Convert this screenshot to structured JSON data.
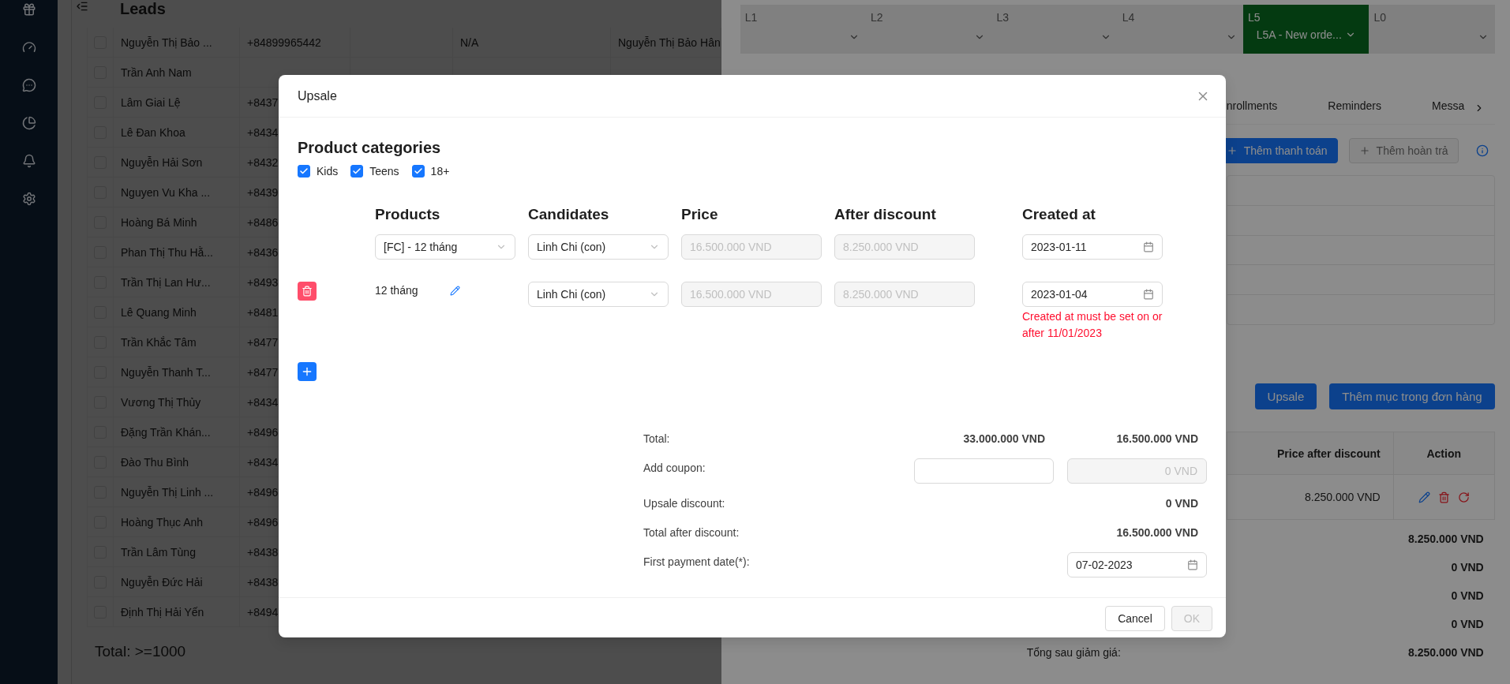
{
  "leads": {
    "title": "Leads",
    "rows": [
      {
        "name": "Nguyễn Thị Bảo ...",
        "phone": "+84899965442",
        "column_4": "N/A",
        "column_5": "Nguyễn Thị Bảo Hân",
        "checked": false
      },
      {
        "name": "Trần Anh Nam",
        "checked": false
      },
      {
        "name": "Lâm Giai Lệ",
        "phone": "+8437",
        "checked": false
      },
      {
        "name": "Lê Đan Khoa",
        "phone": "+8434",
        "checked": false
      },
      {
        "name": "Nguyễn Hải Sơn",
        "phone": "+8432",
        "checked": false
      },
      {
        "name": "Nguyen Vu Kha ...",
        "phone": "+8439",
        "checked": false
      },
      {
        "name": "Hoàng Bá Minh",
        "phone": "+8486",
        "checked": false
      },
      {
        "name": "Phan Thị Thu Hằ...",
        "phone": "+8436",
        "checked": false
      },
      {
        "name": "Trần Thị Lan Hư...",
        "phone": "+8493",
        "checked": false
      },
      {
        "name": "Lê Quang Minh",
        "phone": "+8481",
        "checked": false
      },
      {
        "name": "Trần Khắc Tâm",
        "phone": "+8477",
        "checked": false
      },
      {
        "name": "Nguyễn Thanh T...",
        "phone": "+8477",
        "checked": false
      },
      {
        "name": "Vương Thị Thủy",
        "phone": "+8434",
        "checked": false
      },
      {
        "name": "Đặng Trần Khán...",
        "phone": "+8496",
        "checked": false
      },
      {
        "name": "Đào Thu Bình",
        "phone": "+8434",
        "checked": false
      },
      {
        "name": "Nguyễn Thị Linh ...",
        "phone": "+8496",
        "checked": false
      },
      {
        "name": "Hoàng Thục Anh",
        "phone": "+8496",
        "checked": false
      },
      {
        "name": "Trần Lâm Tùng",
        "phone": "+8438",
        "checked": false
      },
      {
        "name": "Nguyễn Đức Hải",
        "phone": "+8438",
        "checked": false
      },
      {
        "name": "Định Thị Hải Yến",
        "phone": "+8494",
        "checked": false
      }
    ],
    "total": "Total: >=1000"
  },
  "stages": [
    {
      "label": "L1",
      "selected": false
    },
    {
      "label": "L2",
      "selected": false
    },
    {
      "label": "L3",
      "selected": false
    },
    {
      "label": "L4",
      "selected": false
    },
    {
      "label": "L5",
      "value": "L5A - New orde...",
      "selected": true
    },
    {
      "label": "L0",
      "selected": false
    }
  ],
  "tabs": [
    "nrollments",
    "Reminders",
    "Messa"
  ],
  "payment_buttons": [
    {
      "label": "Thêm thanh toán",
      "disabled": false
    },
    {
      "label": "Thêm hoàn trả",
      "disabled": true
    }
  ],
  "order_buttons": [
    "Upsale",
    "Thêm mục trong đơn hàng"
  ],
  "order_table": {
    "columns": [
      "Price after discount",
      "Action"
    ],
    "rows": [
      {
        "price_after_discount": "8.250.000 VND"
      }
    ]
  },
  "order_summary": [
    {
      "value": "8.250.000 VND"
    },
    {
      "value": "0 VND"
    },
    {
      "value": "0 VND"
    },
    {
      "value": "0 VND"
    },
    {
      "label": "Tổng sau giảm giá:",
      "value": "8.250.000 VND"
    }
  ],
  "modal": {
    "title": "Upsale",
    "categories_title": "Product categories",
    "categories": [
      {
        "label": "Kids",
        "checked": true
      },
      {
        "label": "Teens",
        "checked": true
      },
      {
        "label": "18+",
        "checked": true
      }
    ],
    "columns": [
      "Products",
      "Candidates",
      "Price",
      "After discount",
      "Created at"
    ],
    "rows": [
      {
        "kind": "new",
        "product": "[FC] - 12 tháng",
        "candidate": "Linh Chi (con)",
        "price": "16.500.000 VND",
        "after_discount": "8.250.000 VND",
        "created_at": "2023-01-11"
      },
      {
        "kind": "existing",
        "product": "12 tháng",
        "candidate": "Linh Chi (con)",
        "price": "16.500.000 VND",
        "after_discount": "8.250.000 VND",
        "created_at": "2023-01-04",
        "error": "Created at must be set on or after 11/01/2023"
      }
    ],
    "summary": {
      "total_label": "Total:",
      "total": "33.000.000 VND",
      "total_after_coupon": "16.500.000 VND",
      "coupon_label": "Add coupon:",
      "coupon_discount": "0 VND",
      "upsale_discount_label": "Upsale discount:",
      "upsale_discount": "0 VND",
      "total_after_discount_label": "Total after discount:",
      "total_after_discount": "16.500.000 VND",
      "first_payment_label": "First payment date(*):",
      "first_payment_date": "07-02-2023"
    },
    "buttons": [
      {
        "label": "Cancel",
        "disabled": false
      },
      {
        "label": "OK",
        "disabled": true
      }
    ]
  }
}
